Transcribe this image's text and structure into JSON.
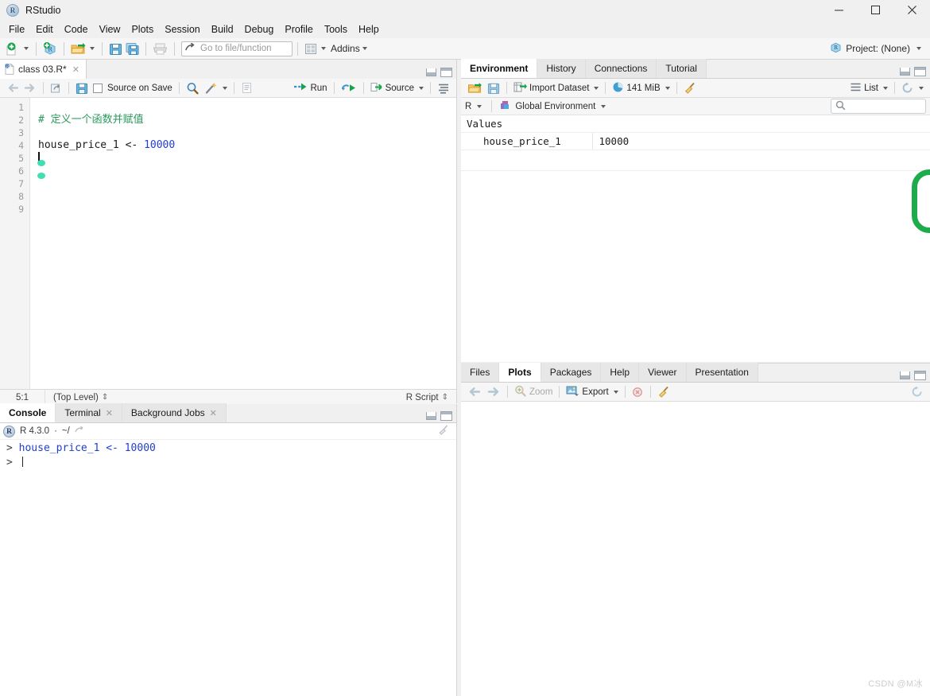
{
  "window": {
    "title": "RStudio",
    "logo_letter": "R",
    "controls": {
      "minimize": "minimize-icon",
      "maximize": "maximize-icon",
      "close": "close-icon"
    }
  },
  "menubar": {
    "items": [
      {
        "label": "File"
      },
      {
        "label": "Edit"
      },
      {
        "label": "Code"
      },
      {
        "label": "View"
      },
      {
        "label": "Plots"
      },
      {
        "label": "Session"
      },
      {
        "label": "Build"
      },
      {
        "label": "Debug"
      },
      {
        "label": "Profile"
      },
      {
        "label": "Tools"
      },
      {
        "label": "Help"
      }
    ]
  },
  "toolbar": {
    "new_file_icon": "new-file-icon",
    "new_project_icon": "new-project-icon",
    "open_file_icon": "open-folder-icon",
    "save_icon": "save-icon",
    "save_all_icon": "save-all-icon",
    "print_icon": "print-icon",
    "goto_arrow_icon": "jump-to-icon",
    "goto_placeholder": "Go to file/function",
    "panes_icon": "workspace-panes-icon",
    "addins_label": "Addins",
    "project_label": "Project: (None)",
    "project_icon": "r-cube-icon"
  },
  "source": {
    "tab": {
      "label": "class 03.R*",
      "icon": "r-script-icon",
      "close": "close-icon"
    },
    "toolbar": {
      "back_icon": "arrow-left-icon",
      "forward_icon": "arrow-right-icon",
      "popout_icon": "show-in-new-window-icon",
      "save_icon": "save-icon",
      "source_on_save_label": "Source on Save",
      "find_icon": "magnifier-icon",
      "magic_icon": "code-tools-icon",
      "compile_report_icon": "compile-report-icon",
      "run_label": "Run",
      "rerun_icon": "rerun-icon",
      "source_label": "Source",
      "outline_icon": "document-outline-icon"
    },
    "gutter_numbers": [
      "1",
      "2",
      "3",
      "4",
      "5",
      "6",
      "7",
      "8",
      "9"
    ],
    "lines": [
      {
        "n": 1,
        "segments": []
      },
      {
        "n": 2,
        "segments": [
          {
            "t": "# 定义一个函数并赋值",
            "c": "cmt"
          }
        ]
      },
      {
        "n": 3,
        "segments": []
      },
      {
        "n": 4,
        "segments": [
          {
            "t": "house_price_1 ",
            "c": "ident"
          },
          {
            "t": "<- ",
            "c": "op"
          },
          {
            "t": "10000",
            "c": "num"
          }
        ]
      },
      {
        "n": 5,
        "segments": []
      },
      {
        "n": 6,
        "segments": []
      },
      {
        "n": 7,
        "segments": []
      },
      {
        "n": 8,
        "segments": []
      },
      {
        "n": 9,
        "segments": []
      }
    ],
    "statusbar": {
      "cursor_position": "5:1",
      "scope": "(Top Level)",
      "file_type": "R Script"
    }
  },
  "console": {
    "tabs": [
      {
        "label": "Console",
        "active": true,
        "closable": false
      },
      {
        "label": "Terminal",
        "active": false,
        "closable": true
      },
      {
        "label": "Background Jobs",
        "active": false,
        "closable": true
      }
    ],
    "info": {
      "version": "R 4.3.0",
      "separator": "·",
      "working_dir": "~/",
      "popout_icon": "popout-icon"
    },
    "clear_icon": "broom-icon",
    "lines": [
      {
        "prompt": "> ",
        "code": "house_price_1 <- 10000"
      },
      {
        "prompt": "> ",
        "code": ""
      }
    ]
  },
  "environment": {
    "tabs": [
      {
        "label": "Environment",
        "active": true
      },
      {
        "label": "History",
        "active": false
      },
      {
        "label": "Connections",
        "active": false
      },
      {
        "label": "Tutorial",
        "active": false
      }
    ],
    "toolbar": {
      "load_icon": "open-folder-icon",
      "save_icon": "save-icon",
      "import_dataset_label": "Import Dataset",
      "memory_label": "141 MiB",
      "memory_icon": "memory-pie-icon",
      "clear_icon": "broom-icon",
      "view_mode_label": "List",
      "view_mode_icon": "list-icon",
      "refresh_icon": "refresh-icon"
    },
    "context": {
      "language_label": "R",
      "scope_label": "Global Environment",
      "scope_icon": "globe-cube-icon",
      "search_icon": "search-icon",
      "search_value": "",
      "search_placeholder": ""
    },
    "groups": [
      {
        "name": "Values",
        "rows": [
          {
            "name": "house_price_1",
            "value": "10000"
          }
        ]
      }
    ],
    "annotation": {
      "shape": "rounded-rectangle",
      "color": "#1eab4b"
    }
  },
  "plots": {
    "tabs": [
      {
        "label": "Files",
        "active": false
      },
      {
        "label": "Plots",
        "active": true
      },
      {
        "label": "Packages",
        "active": false
      },
      {
        "label": "Help",
        "active": false
      },
      {
        "label": "Viewer",
        "active": false
      },
      {
        "label": "Presentation",
        "active": false
      }
    ],
    "toolbar": {
      "back_icon": "arrow-left-icon",
      "forward_icon": "arrow-right-icon",
      "zoom_label": "Zoom",
      "zoom_icon": "magnifier-plus-icon",
      "export_label": "Export",
      "export_icon": "export-image-icon",
      "remove_icon": "remove-plot-icon",
      "clear_all_icon": "broom-icon",
      "refresh_icon": "refresh-icon"
    }
  },
  "watermark": {
    "text": "CSDN @M冰"
  },
  "colors": {
    "accent_green": "#1eab4b",
    "comment_green": "#2a9a5b",
    "number_blue": "#1f3fd0",
    "console_blue": "#1f3fd0",
    "chrome_gray": "#f0f0f0"
  }
}
